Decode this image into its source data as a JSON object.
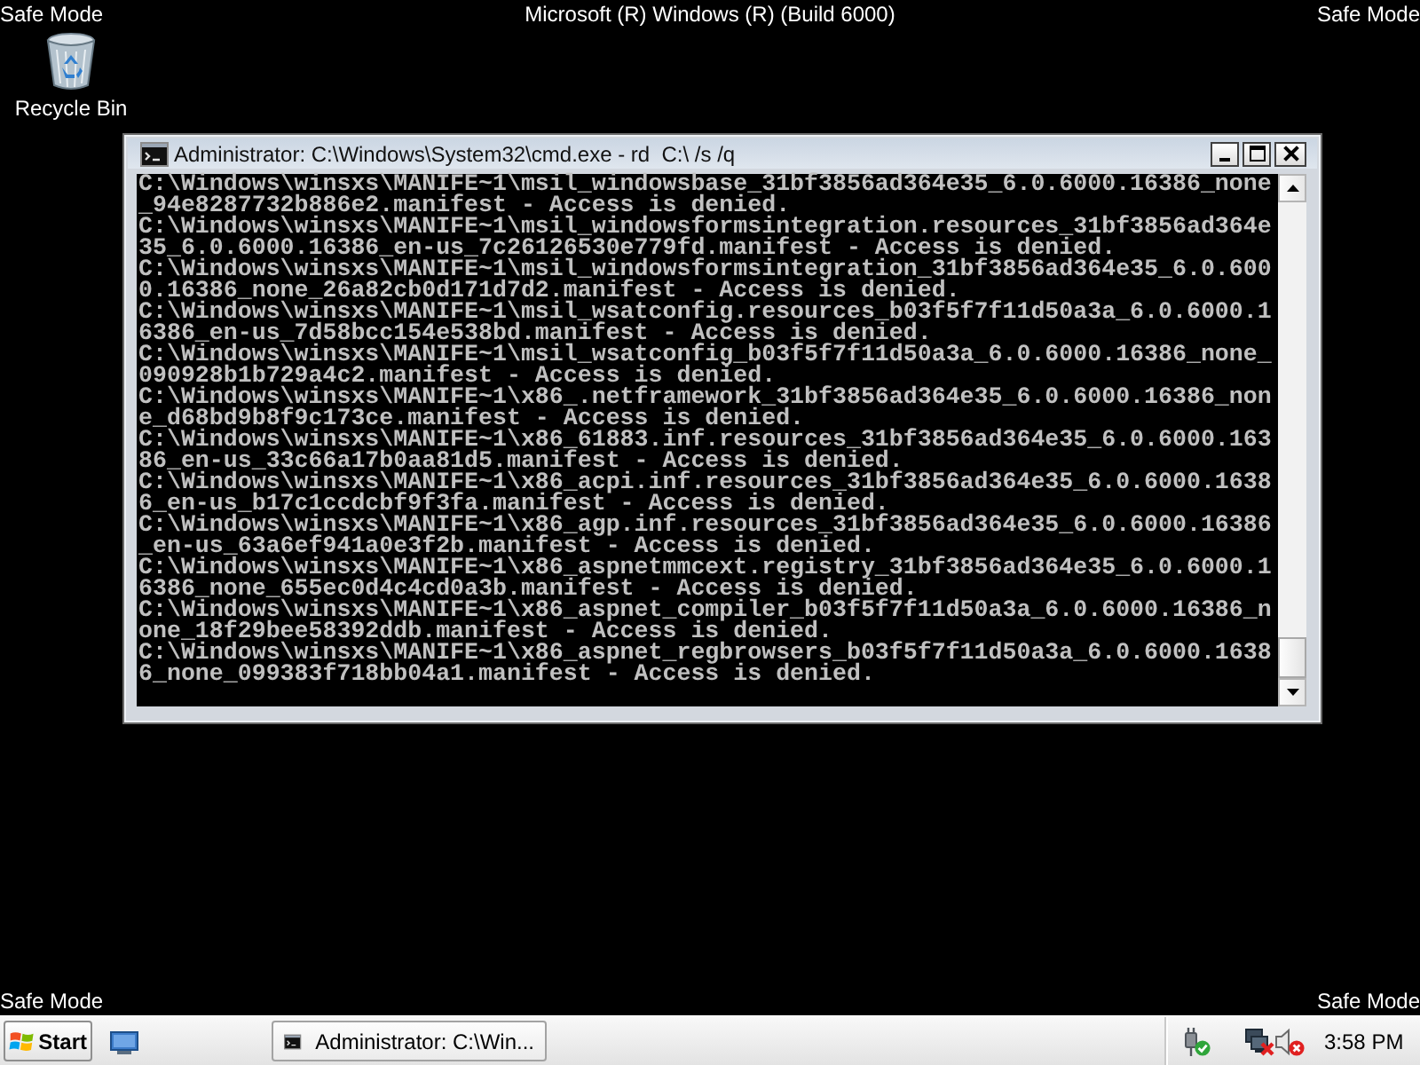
{
  "desktop": {
    "top_left_label": "Safe Mode",
    "top_center_label": "Microsoft (R) Windows (R) (Build 6000)",
    "top_right_label": "Safe Mode",
    "icons": [
      {
        "label": "Recycle Bin"
      }
    ],
    "bottom_left_label": "Safe Mode",
    "bottom_right_label": "Safe Mode"
  },
  "window": {
    "title": "Administrator: C:\\Windows\\System32\\cmd.exe - rd  C:\\ /s /q",
    "console_lines": [
      "C:\\Windows\\winsxs\\MANIFE~1\\msil_windowsbase_31bf3856ad364e35_6.0.6000.16386_none",
      "_94e8287732b886e2.manifest - Access is denied.",
      "C:\\Windows\\winsxs\\MANIFE~1\\msil_windowsformsintegration.resources_31bf3856ad364e",
      "35_6.0.6000.16386_en-us_7c26126530e779fd.manifest - Access is denied.",
      "C:\\Windows\\winsxs\\MANIFE~1\\msil_windowsformsintegration_31bf3856ad364e35_6.0.600",
      "0.16386_none_26a82cb0d171d7d2.manifest - Access is denied.",
      "C:\\Windows\\winsxs\\MANIFE~1\\msil_wsatconfig.resources_b03f5f7f11d50a3a_6.0.6000.1",
      "6386_en-us_7d58bcc154e538bd.manifest - Access is denied.",
      "C:\\Windows\\winsxs\\MANIFE~1\\msil_wsatconfig_b03f5f7f11d50a3a_6.0.6000.16386_none_",
      "090928b1b729a4c2.manifest - Access is denied.",
      "C:\\Windows\\winsxs\\MANIFE~1\\x86_.netframework_31bf3856ad364e35_6.0.6000.16386_non",
      "e_d68bd9b8f9c173ce.manifest - Access is denied.",
      "C:\\Windows\\winsxs\\MANIFE~1\\x86_61883.inf.resources_31bf3856ad364e35_6.0.6000.163",
      "86_en-us_33c66a17b0aa81d5.manifest - Access is denied.",
      "C:\\Windows\\winsxs\\MANIFE~1\\x86_acpi.inf.resources_31bf3856ad364e35_6.0.6000.1638",
      "6_en-us_b17c1ccdcbf9f3fa.manifest - Access is denied.",
      "C:\\Windows\\winsxs\\MANIFE~1\\x86_agp.inf.resources_31bf3856ad364e35_6.0.6000.16386",
      "_en-us_63a6ef941a0e3f2b.manifest - Access is denied.",
      "C:\\Windows\\winsxs\\MANIFE~1\\x86_aspnetmmcext.registry_31bf3856ad364e35_6.0.6000.1",
      "6386_none_655ec0d4c4cd0a3b.manifest - Access is denied.",
      "C:\\Windows\\winsxs\\MANIFE~1\\x86_aspnet_compiler_b03f5f7f11d50a3a_6.0.6000.16386_n",
      "one_18f29bee58392ddb.manifest - Access is denied.",
      "C:\\Windows\\winsxs\\MANIFE~1\\x86_aspnet_regbrowsers_b03f5f7f11d50a3a_6.0.6000.1638",
      "6_none_099383f718bb04a1.manifest - Access is denied."
    ]
  },
  "taskbar": {
    "start_label": "Start",
    "buttons": [
      {
        "label": "Administrator: C:\\Win...",
        "selected": false
      }
    ],
    "clock": "3:58 PM"
  }
}
